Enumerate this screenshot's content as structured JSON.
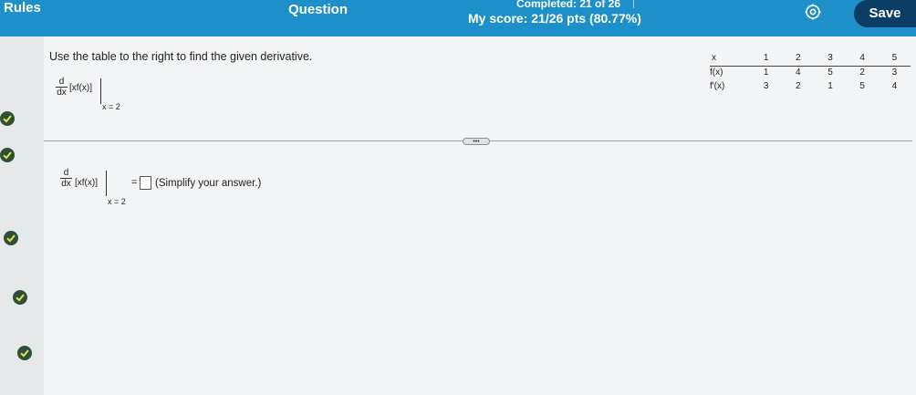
{
  "header": {
    "rules_label": "Rules",
    "question_label": "Question",
    "completed": "Completed: 21 of 26",
    "score": "My score: 21/26 pts (80.77%)",
    "settings_icon": "gear-icon",
    "save_label": "Save",
    "bg_color": "#1d8fc9",
    "save_color": "#0b3d66"
  },
  "sidebar": {
    "check_icon": "check-circle-icon",
    "check_count": 5
  },
  "question": {
    "instruction": "Use the table to the right to find the given derivative.",
    "deriv_num": "d",
    "deriv_den": "dx",
    "deriv_expr": "[xf(x)]",
    "eval_at": "x = 2",
    "equals": "=",
    "answer_value": "",
    "answer_hint": "(Simplify your answer.)",
    "more_label": "•••"
  },
  "table": {
    "header": [
      "x",
      "1",
      "2",
      "3",
      "4",
      "5"
    ],
    "rows": [
      [
        "f(x)",
        "1",
        "4",
        "5",
        "2",
        "3"
      ],
      [
        "f′(x)",
        "3",
        "2",
        "1",
        "5",
        "4"
      ]
    ]
  }
}
